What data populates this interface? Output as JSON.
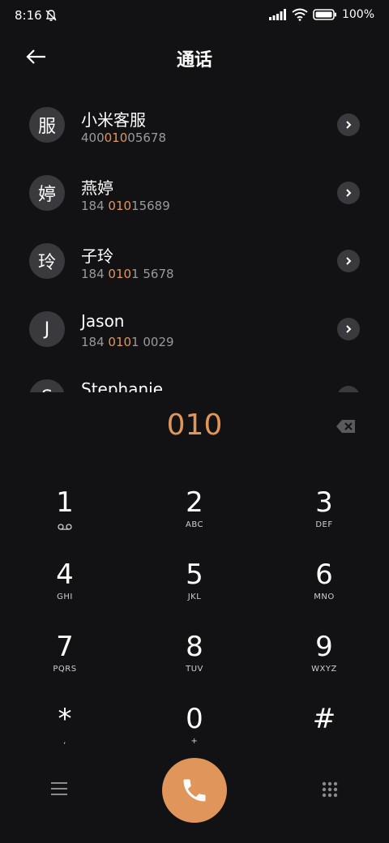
{
  "status": {
    "time": "8:16",
    "battery": "100%"
  },
  "header": {
    "title": "通话"
  },
  "contacts": [
    {
      "avatar": "服",
      "name": "小米客服",
      "num_pre": "400",
      "num_hl": "010",
      "num_post": "05678"
    },
    {
      "avatar": "婷",
      "name": "燕婷",
      "num_pre": "184 ",
      "num_hl": "010",
      "num_post": "15689"
    },
    {
      "avatar": "玲",
      "name": "子玲",
      "num_pre": "184 ",
      "num_hl": "010",
      "num_post": "1 5678"
    },
    {
      "avatar": "J",
      "name": "Jason",
      "num_pre": "184 ",
      "num_hl": "010",
      "num_post": "1 0029"
    },
    {
      "avatar": "S",
      "name": "Stephanie",
      "num_pre": "",
      "num_hl": "",
      "num_post": ""
    }
  ],
  "entry": {
    "digits": "010"
  },
  "keypad": [
    {
      "num": "1",
      "sub": ""
    },
    {
      "num": "2",
      "sub": "ABC"
    },
    {
      "num": "3",
      "sub": "DEF"
    },
    {
      "num": "4",
      "sub": "GHI"
    },
    {
      "num": "5",
      "sub": "JKL"
    },
    {
      "num": "6",
      "sub": "MNO"
    },
    {
      "num": "7",
      "sub": "PQRS"
    },
    {
      "num": "8",
      "sub": "TUV"
    },
    {
      "num": "9",
      "sub": "WXYZ"
    },
    {
      "num": "*",
      "sub": ","
    },
    {
      "num": "0",
      "sub": "+"
    },
    {
      "num": "#",
      "sub": ""
    }
  ],
  "colors": {
    "accent": "#e0965a",
    "background": "#121214"
  },
  "icons": {
    "bell": "bell-off-icon",
    "signal": "signal-icon",
    "wifi": "wifi-icon",
    "battery": "battery-icon",
    "back": "back-arrow-icon",
    "voicemail": "voicemail-icon",
    "backspace": "backspace-icon",
    "menu": "menu-icon",
    "call": "phone-icon",
    "dialpad": "dialpad-icon"
  }
}
